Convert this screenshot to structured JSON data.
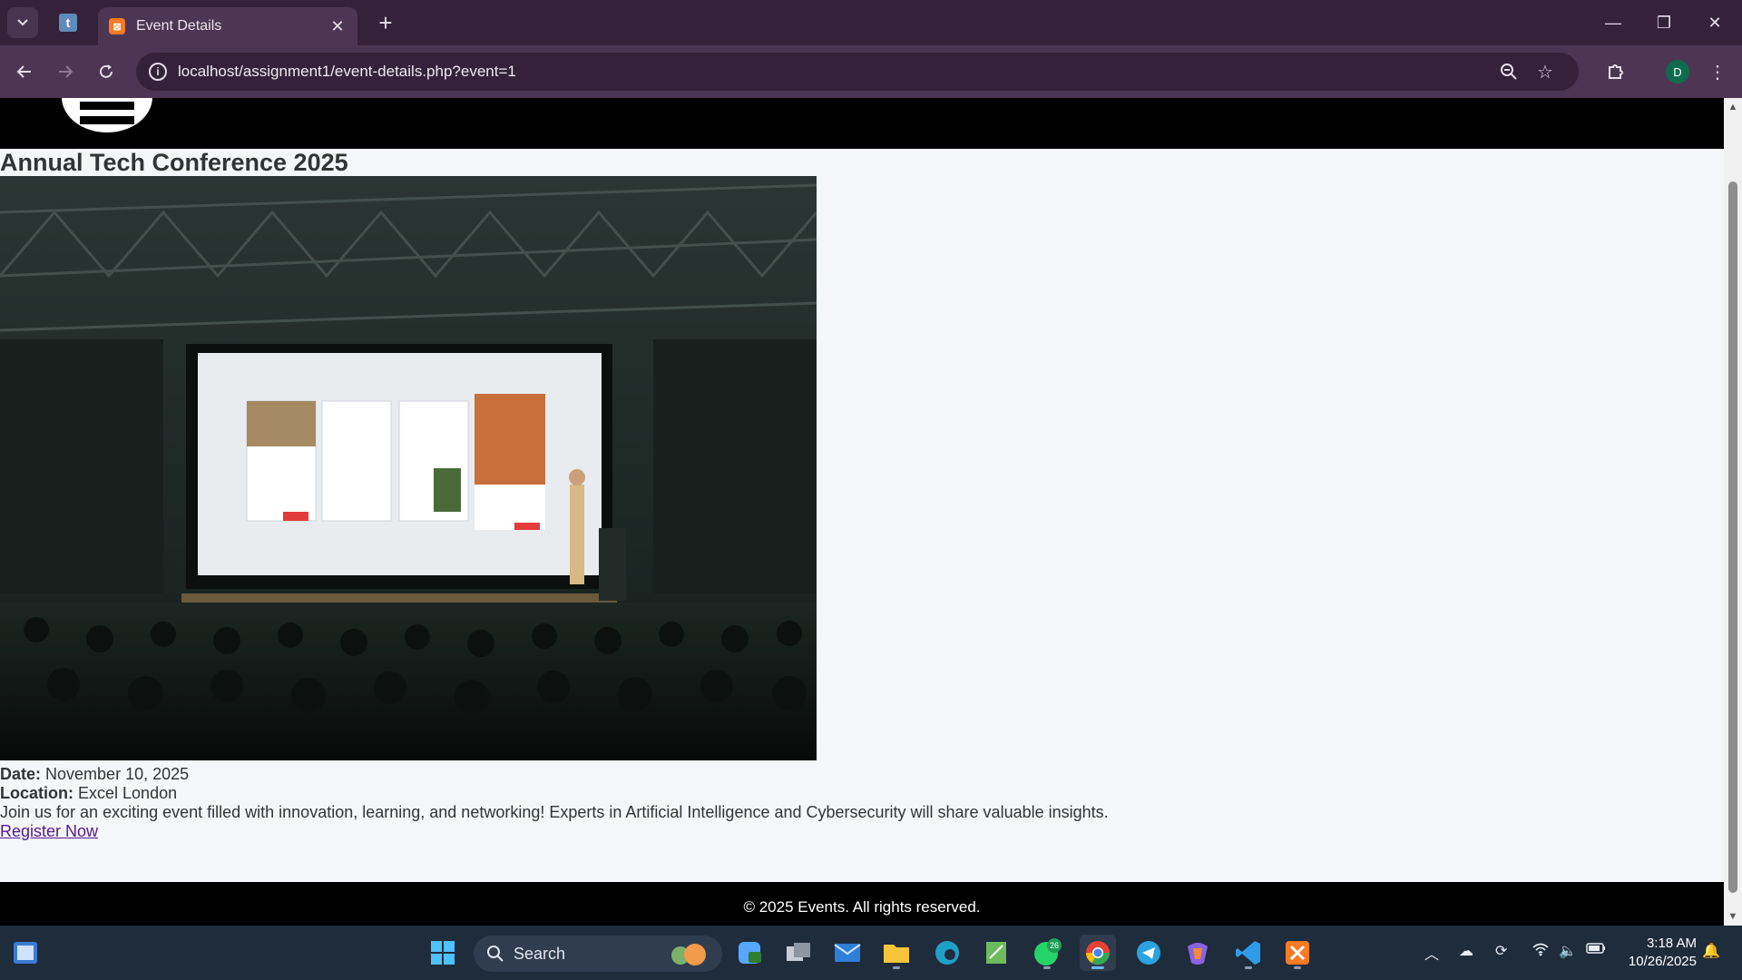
{
  "browser": {
    "tab_title": "Event Details",
    "url": "localhost/assignment1/event-details.php?event=1",
    "profile_initial": "D",
    "pinned_tab_letter": "t"
  },
  "page": {
    "event": {
      "title": "Annual Tech Conference 2025",
      "image_alt": "Speaker presenting on stage to a large audience",
      "date_label": "Date:",
      "date": "November 10, 2025",
      "location_label": "Location:",
      "location": "Excel London",
      "description": "Join us for an exciting event filled with innovation, learning, and networking! Experts in Artificial Intelligence and Cybersecurity will share valuable insights.",
      "register_label": "Register Now"
    },
    "footer_text": "© 2025 Events. All rights reserved."
  },
  "taskbar": {
    "search_label": "Search",
    "whatsapp_badge": "26",
    "time": "3:18 AM",
    "date": "10/26/2025"
  },
  "icons": {
    "tab_list": "chevron-down-icon",
    "back": "back-arrow-icon",
    "forward": "forward-arrow-icon",
    "reload": "reload-icon",
    "zoom": "zoom-icon",
    "bookmark": "star-icon",
    "extensions": "puzzle-icon",
    "menu": "kebab-menu-icon"
  },
  "colors": {
    "chrome_dark": "#35223a",
    "chrome_toolbar": "#4d3653",
    "site_header": "#000000",
    "page_bg": "#f4f6f9",
    "link_visited": "#551a8b",
    "taskbar": "#1f2c3c"
  }
}
